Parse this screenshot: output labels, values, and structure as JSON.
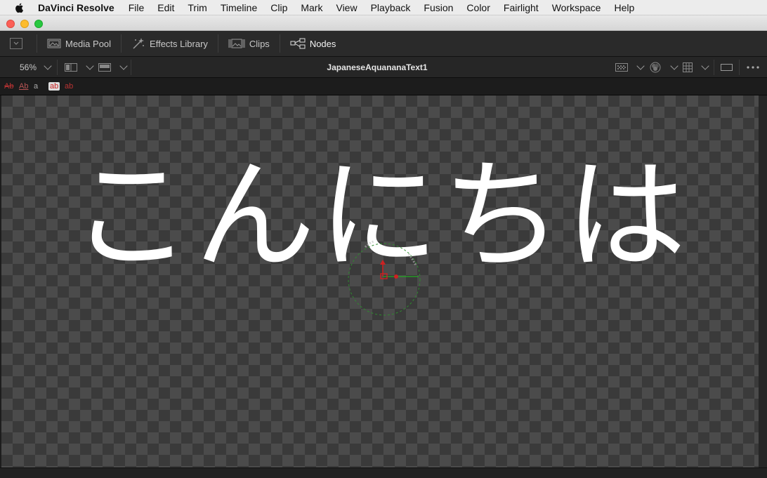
{
  "menubar": {
    "app_name": "DaVinci Resolve",
    "items": [
      "File",
      "Edit",
      "Trim",
      "Timeline",
      "Clip",
      "Mark",
      "View",
      "Playback",
      "Fusion",
      "Color",
      "Fairlight",
      "Workspace",
      "Help"
    ]
  },
  "toolbar": {
    "media_pool": "Media Pool",
    "effects_library": "Effects Library",
    "clips": "Clips",
    "nodes": "Nodes"
  },
  "viewer": {
    "zoom": "56%",
    "title": "JapaneseAquananaText1",
    "text": "こんにちは"
  },
  "subbar": {
    "items": [
      "Ab",
      "Ab",
      "a",
      "ab",
      "ab"
    ]
  },
  "colors": {
    "accent_red": "#cc2222",
    "axis_green": "#22aa22",
    "text_white": "#ffffff"
  }
}
